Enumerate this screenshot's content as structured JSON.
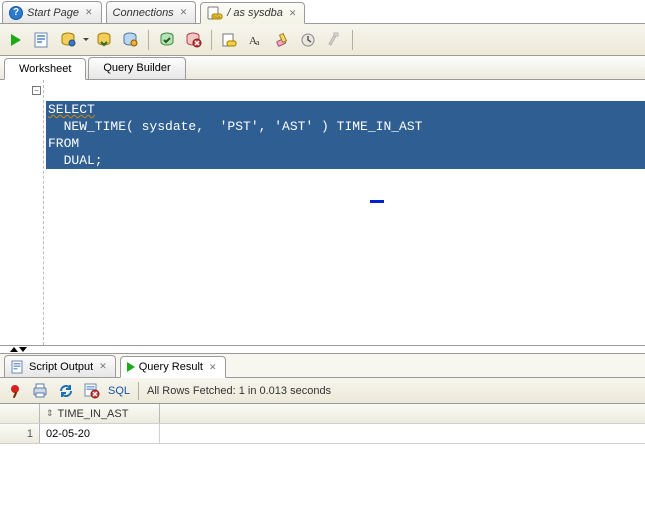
{
  "tabs": {
    "start": "Start Page",
    "connections": "Connections",
    "worksheet": "/ as sysdba"
  },
  "sheet_tabs": {
    "worksheet": "Worksheet",
    "query_builder": "Query Builder"
  },
  "sql": {
    "line1": "SELECT",
    "line2": "  NEW_TIME( sysdate,  'PST', 'AST' ) TIME_IN_AST",
    "line3": "FROM",
    "line4": "  DUAL;"
  },
  "result_tabs": {
    "script_output": "Script Output",
    "query_result": "Query Result"
  },
  "result_toolbar": {
    "sql_label": "SQL",
    "status": "All Rows Fetched: 1 in 0.013 seconds"
  },
  "grid": {
    "col0_header": "TIME_IN_AST",
    "rows": [
      {
        "n": "1",
        "c0": "02-05-20"
      }
    ]
  },
  "fold_glyph": "−"
}
